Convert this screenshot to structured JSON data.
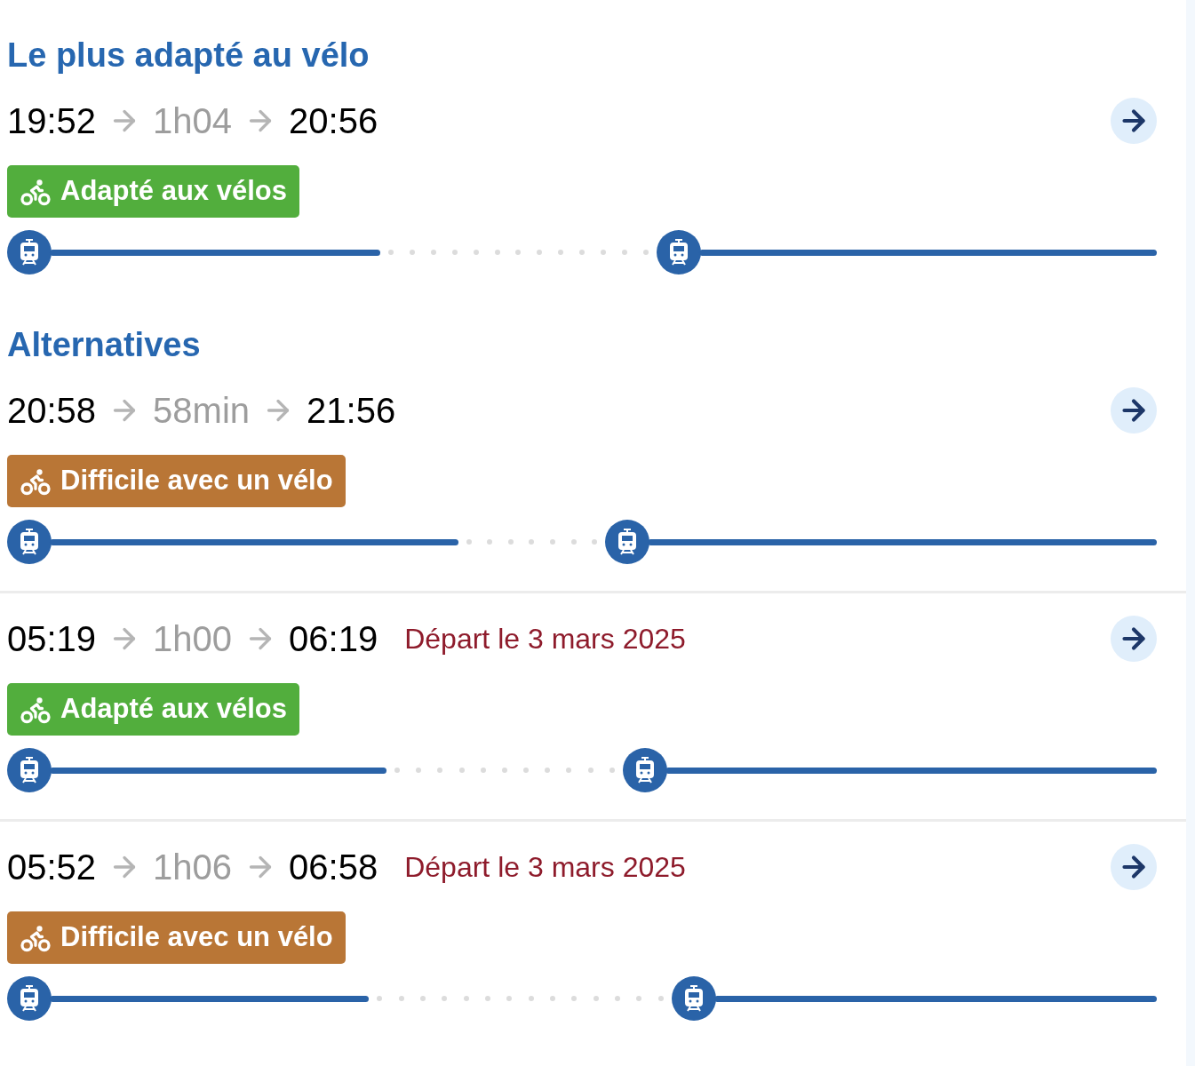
{
  "sections": [
    {
      "title": "Le plus adapté au vélo",
      "journeys": [
        {
          "departure": "19:52",
          "duration": "1h04",
          "arrival": "20:56",
          "bike": {
            "kind": "suitable",
            "label": "Adapté aux vélos"
          }
        }
      ]
    },
    {
      "title": "Alternatives",
      "journeys": [
        {
          "departure": "20:58",
          "duration": "58min",
          "arrival": "21:56",
          "bike": {
            "kind": "difficult",
            "label": "Difficile avec un vélo"
          }
        },
        {
          "departure": "05:19",
          "duration": "1h00",
          "arrival": "06:19",
          "note": "Départ le 3 mars 2025",
          "bike": {
            "kind": "suitable",
            "label": "Adapté aux vélos"
          }
        },
        {
          "departure": "05:52",
          "duration": "1h06",
          "arrival": "06:58",
          "note": "Départ le 3 mars 2025",
          "bike": {
            "kind": "difficult",
            "label": "Difficile avec un vélo"
          }
        }
      ]
    }
  ]
}
